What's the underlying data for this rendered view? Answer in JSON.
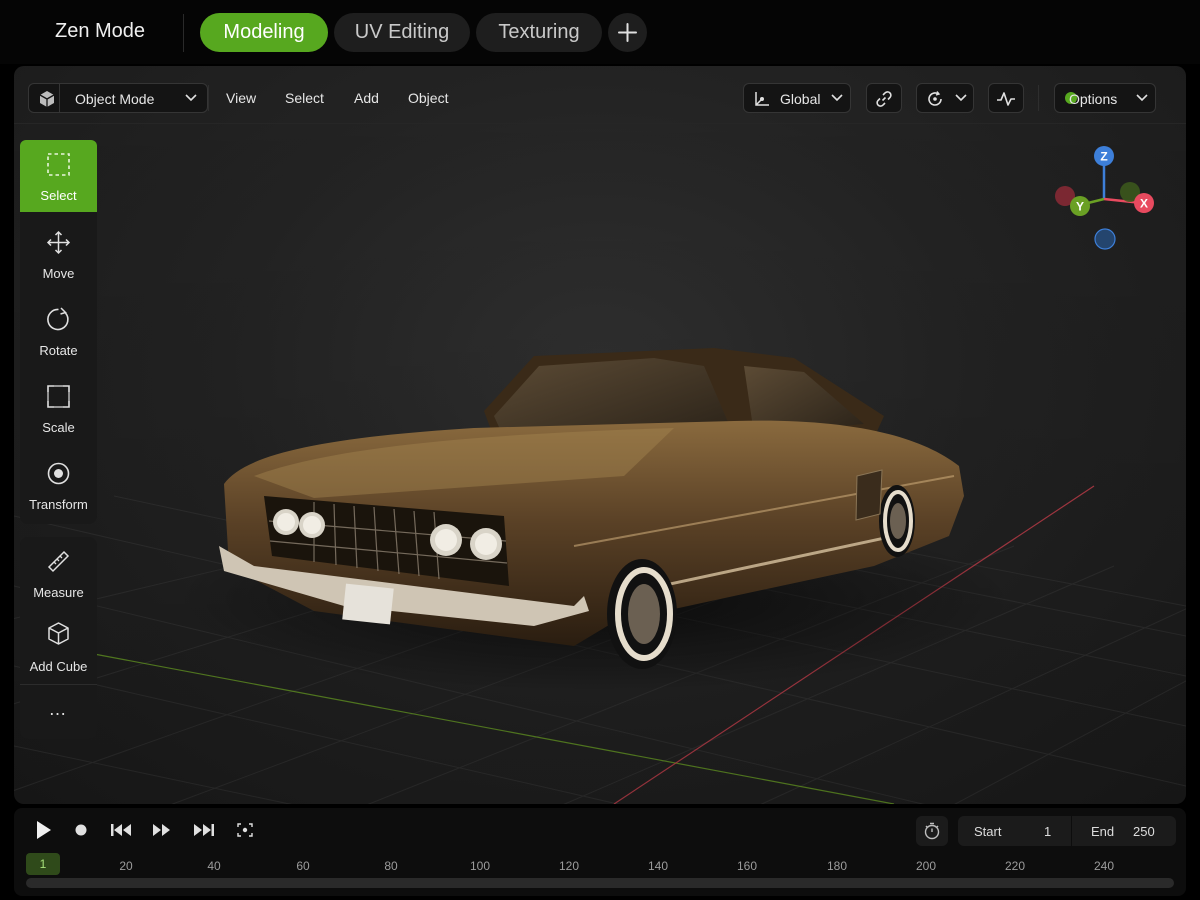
{
  "app": {
    "title": "Zen Mode"
  },
  "workspace_tabs": [
    {
      "label": "Modeling",
      "active": true
    },
    {
      "label": "UV Editing",
      "active": false
    },
    {
      "label": "Texturing",
      "active": false
    }
  ],
  "header": {
    "mode_label": "Object Mode",
    "menus": [
      "View",
      "Select",
      "Add",
      "Object"
    ],
    "orientation_label": "Global",
    "options_label": "Options"
  },
  "tools": [
    {
      "label": "Select",
      "icon": "select-box-icon",
      "active": true
    },
    {
      "label": "Move",
      "icon": "move-arrows-icon",
      "active": false
    },
    {
      "label": "Rotate",
      "icon": "rotate-icon",
      "active": false
    },
    {
      "label": "Scale",
      "icon": "scale-icon",
      "active": false
    },
    {
      "label": "Transform",
      "icon": "transform-icon",
      "active": false
    }
  ],
  "tools_secondary": [
    {
      "label": "Measure",
      "icon": "ruler-icon"
    },
    {
      "label": "Add Cube",
      "icon": "cube-icon"
    },
    {
      "label": "…",
      "icon": "more-icon"
    }
  ],
  "gizmo": {
    "x_label": "X",
    "y_label": "Y",
    "z_label": "Z"
  },
  "timeline": {
    "start_label": "Start",
    "start_value": "1",
    "end_label": "End",
    "end_value": "250",
    "current_frame": "1",
    "ticks": [
      "20",
      "40",
      "60",
      "80",
      "100",
      "120",
      "140",
      "160",
      "180",
      "200",
      "220",
      "240"
    ]
  },
  "colors": {
    "accent": "#57a81f",
    "axis_x": "#e84a5f",
    "axis_y": "#6aa024",
    "axis_z": "#3d7fd9"
  }
}
